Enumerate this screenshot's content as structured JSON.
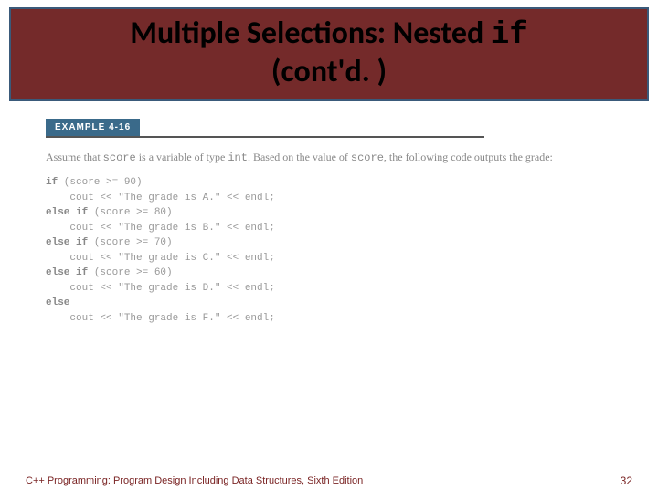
{
  "title": {
    "line1_prefix": "Multiple Selections: Nested ",
    "line1_mono": "if",
    "line2": "(cont'd. )"
  },
  "example_label": "EXAMPLE 4-16",
  "intro": {
    "t1": "Assume that ",
    "m1": "score",
    "t2": " is a variable of type ",
    "m2": "int",
    "t3": ". Based on the value of ",
    "m3": "score",
    "t4": ", the following code outputs the grade:"
  },
  "code_lines": [
    {
      "kw": "if",
      "rest": " (score >= 90)"
    },
    {
      "kw": "",
      "rest": "    cout << \"The grade is A.\" << endl;"
    },
    {
      "kw": "else if",
      "rest": " (score >= 80)"
    },
    {
      "kw": "",
      "rest": "    cout << \"The grade is B.\" << endl;"
    },
    {
      "kw": "else if",
      "rest": " (score >= 70)"
    },
    {
      "kw": "",
      "rest": "    cout << \"The grade is C.\" << endl;"
    },
    {
      "kw": "else if",
      "rest": " (score >= 60)"
    },
    {
      "kw": "",
      "rest": "    cout << \"The grade is D.\" << endl;"
    },
    {
      "kw": "else",
      "rest": ""
    },
    {
      "kw": "",
      "rest": "    cout << \"The grade is F.\" << endl;"
    }
  ],
  "footer": {
    "text": "C++ Programming: Program Design Including Data Structures, Sixth Edition",
    "page": "32"
  }
}
